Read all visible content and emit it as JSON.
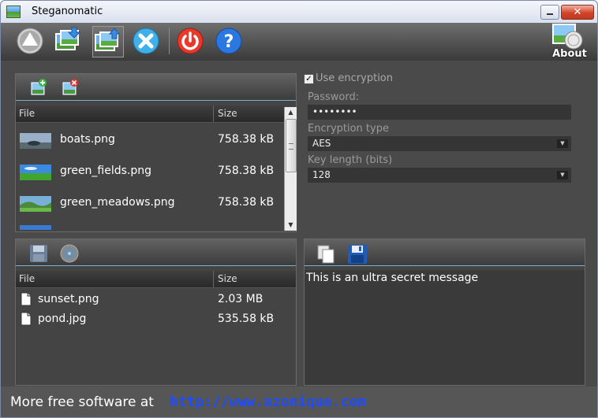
{
  "window": {
    "title": "Steganomatic",
    "close_glyph": "✕"
  },
  "toolbar": {
    "buttons": [
      {
        "icon": "eject-icon"
      },
      {
        "icon": "hide-in-image-icon"
      },
      {
        "icon": "extract-from-image-icon"
      },
      {
        "icon": "clear-icon"
      },
      {
        "icon": "power-icon"
      },
      {
        "icon": "help-icon"
      }
    ],
    "about_label": "About"
  },
  "carriers": {
    "header": {
      "file": "File",
      "size": "Size"
    },
    "rows": [
      {
        "name": "boats.png",
        "size": "758.38 kB"
      },
      {
        "name": "green_fields.png",
        "size": "758.38 kB"
      },
      {
        "name": "green_meadows.png",
        "size": "758.38 kB"
      }
    ]
  },
  "encryption": {
    "use_label": "Use encryption",
    "checked": true,
    "password_label": "Password:",
    "password_value": "••••••••",
    "type_label": "Encryption type",
    "type_value": "AES",
    "key_label": "Key length (bits)",
    "key_value": "128"
  },
  "hidden_files": {
    "header": {
      "file": "File",
      "size": "Size"
    },
    "rows": [
      {
        "name": "sunset.png",
        "size": "2.03 MB"
      },
      {
        "name": "pond.jpg",
        "size": "535.58 kB"
      }
    ]
  },
  "message": {
    "text": "This is an ultra secret message"
  },
  "footer": {
    "text": "More free software at",
    "link": "http://www.azonique.com"
  },
  "colors": {
    "link": "#1e4cff",
    "toolbar_accent": "#7fb0d0"
  }
}
